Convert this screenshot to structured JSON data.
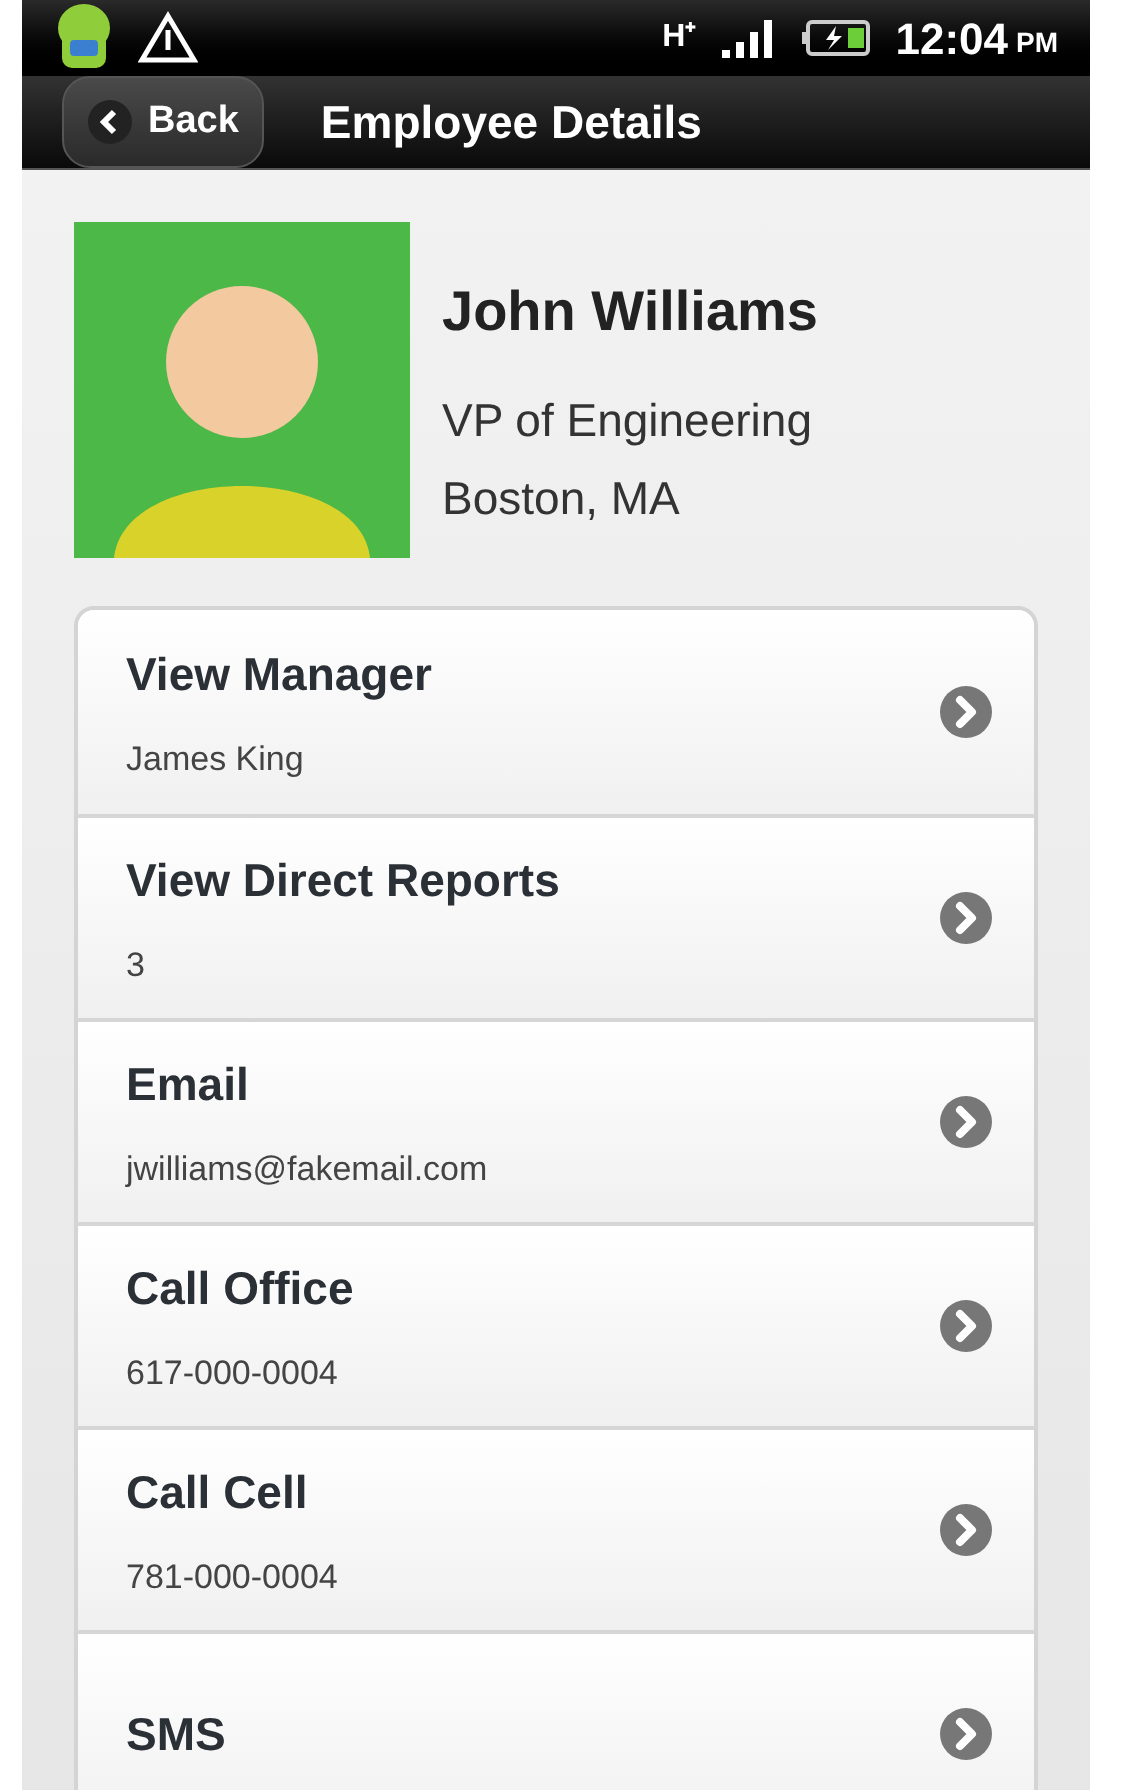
{
  "status_bar": {
    "network": "H⁺",
    "time": "12:04",
    "ampm": "PM"
  },
  "header": {
    "back": "Back",
    "title": "Employee Details"
  },
  "employee": {
    "name": "John Williams",
    "title": "VP of Engineering",
    "location": "Boston, MA"
  },
  "actions": [
    {
      "title": "View Manager",
      "subtitle": "James King"
    },
    {
      "title": "View Direct Reports",
      "subtitle": "3"
    },
    {
      "title": "Email",
      "subtitle": "jwilliams@fakemail.com"
    },
    {
      "title": "Call Office",
      "subtitle": "617-000-0004"
    },
    {
      "title": "Call Cell",
      "subtitle": "781-000-0004"
    },
    {
      "title": "SMS"
    }
  ]
}
